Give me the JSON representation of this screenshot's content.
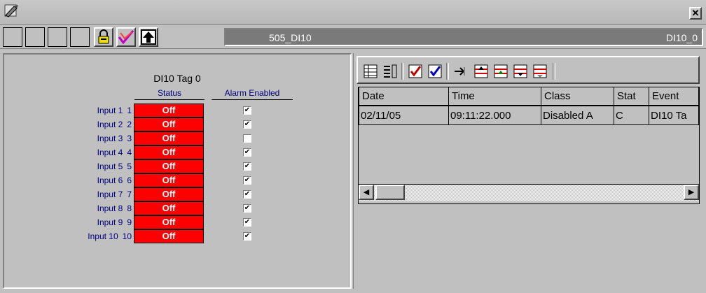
{
  "window": {
    "close_glyph": "✕"
  },
  "toolbar": {
    "tag_name": "505_DI10",
    "tag_name_right": "DI10_0"
  },
  "di_panel": {
    "title": "DI10 Tag 0",
    "status_header": "Status",
    "alarm_header": "Alarm Enabled",
    "inputs": [
      {
        "label": "Input 1",
        "num": "1",
        "status": "Off",
        "alarm_enabled": true
      },
      {
        "label": "Input 2",
        "num": "2",
        "status": "Off",
        "alarm_enabled": true
      },
      {
        "label": "Input 3",
        "num": "3",
        "status": "Off",
        "alarm_enabled": false
      },
      {
        "label": "Input 4",
        "num": "4",
        "status": "Off",
        "alarm_enabled": true
      },
      {
        "label": "Input 5",
        "num": "5",
        "status": "Off",
        "alarm_enabled": true
      },
      {
        "label": "Input 6",
        "num": "6",
        "status": "Off",
        "alarm_enabled": true
      },
      {
        "label": "Input 7",
        "num": "7",
        "status": "Off",
        "alarm_enabled": true
      },
      {
        "label": "Input 8",
        "num": "8",
        "status": "Off",
        "alarm_enabled": true
      },
      {
        "label": "Input 9",
        "num": "9",
        "status": "Off",
        "alarm_enabled": true
      },
      {
        "label": "Input 10",
        "num": "10",
        "status": "Off",
        "alarm_enabled": true
      }
    ],
    "status_color": "#ff0000",
    "check_glyph": "✔"
  },
  "event_grid": {
    "columns": [
      "Date",
      "Time",
      "Class",
      "Stat",
      "Event"
    ],
    "rows": [
      [
        "02/11/05",
        "09:11:22.000",
        "Disabled A",
        "C",
        "DI10 Ta"
      ]
    ],
    "scroll_left_glyph": "◀",
    "scroll_right_glyph": "▶"
  }
}
